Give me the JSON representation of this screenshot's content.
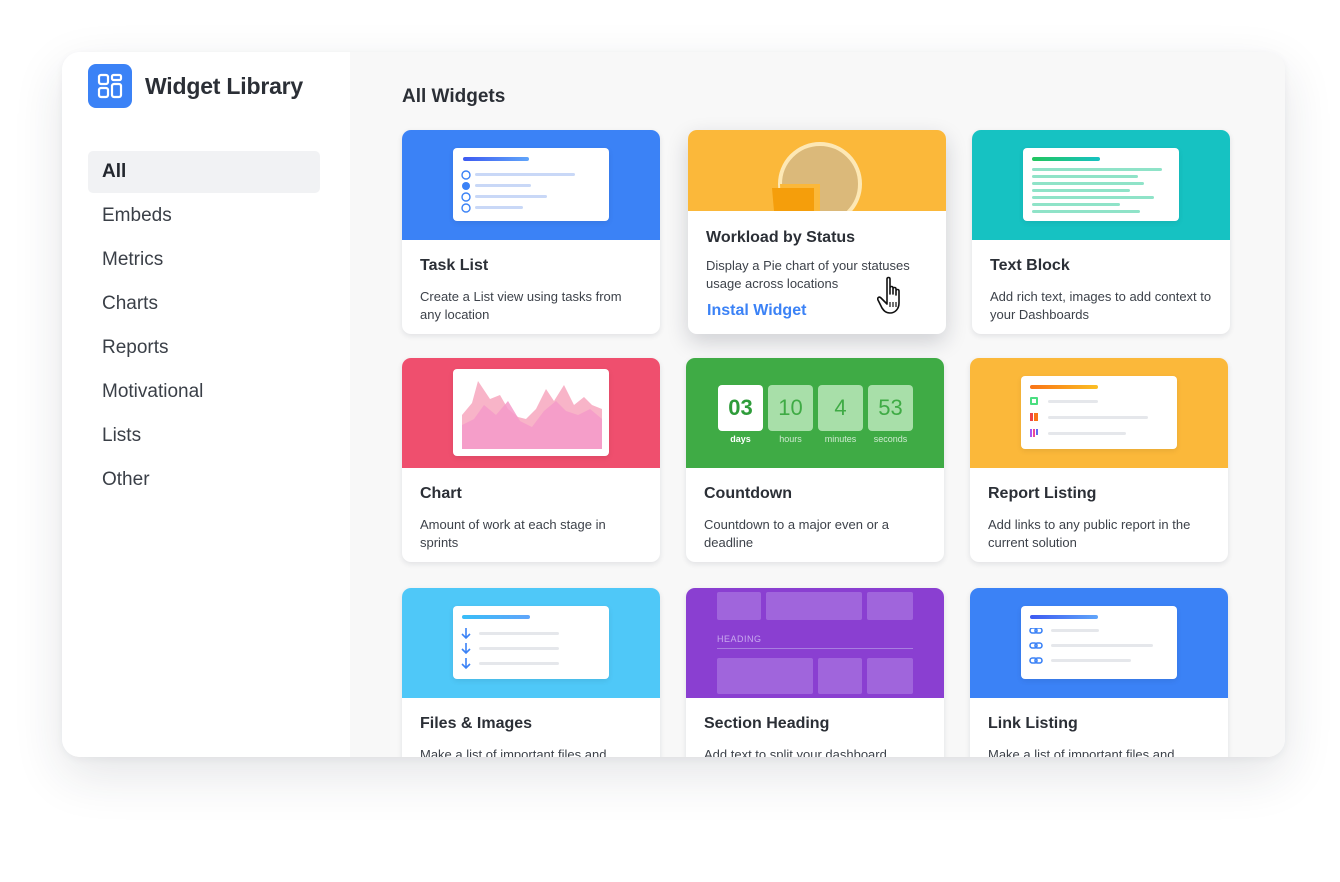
{
  "app": {
    "title": "Widget Library"
  },
  "sidebar": {
    "items": [
      {
        "label": "All",
        "active": true
      },
      {
        "label": "Embeds"
      },
      {
        "label": "Metrics"
      },
      {
        "label": "Charts"
      },
      {
        "label": "Reports"
      },
      {
        "label": "Motivational"
      },
      {
        "label": "Lists"
      },
      {
        "label": "Other"
      }
    ]
  },
  "main": {
    "title": "All Widgets",
    "cards": [
      {
        "title": "Task List",
        "description": "Create a List view using tasks from any location",
        "color": "#3b82f6",
        "icon": "task-list-preview"
      },
      {
        "title": "Workload by Status",
        "description": "Display a Pie chart of your statuses usage across locations",
        "color": "#fbb83a",
        "icon": "pie-chart-preview",
        "action": "Instal Widget",
        "hovered": true
      },
      {
        "title": "Text Block",
        "description": "Add rich text, images to add context to your Dashboards",
        "color": "#16c2c2",
        "icon": "text-block-preview"
      },
      {
        "title": "Chart",
        "description": "Amount of work at each stage in sprints",
        "color": "#ef4f6e",
        "icon": "area-chart-preview"
      },
      {
        "title": "Countdown",
        "description": "Countdown to a major even or a deadline",
        "color": "#3fab45",
        "icon": "countdown-preview",
        "countdown": [
          {
            "value": "03",
            "unit": "days"
          },
          {
            "value": "10",
            "unit": "hours"
          },
          {
            "value": "4",
            "unit": "minutes"
          },
          {
            "value": "53",
            "unit": "seconds"
          }
        ]
      },
      {
        "title": "Report Listing",
        "description": "Add links to any public report in the current solution",
        "color": "#fbb83a",
        "icon": "report-listing-preview"
      },
      {
        "title": "Files & Images",
        "description": "Make a list of important files and",
        "color": "#4fc8f8",
        "icon": "files-preview"
      },
      {
        "title": "Section Heading",
        "description": "Add text to split your dashboard sections",
        "color": "#8a3fd1",
        "icon": "section-heading-preview",
        "heading_label": "HEADING"
      },
      {
        "title": "Link Listing",
        "description": "Make a list of important files and",
        "color": "#3b82f6",
        "icon": "link-listing-preview"
      }
    ]
  }
}
